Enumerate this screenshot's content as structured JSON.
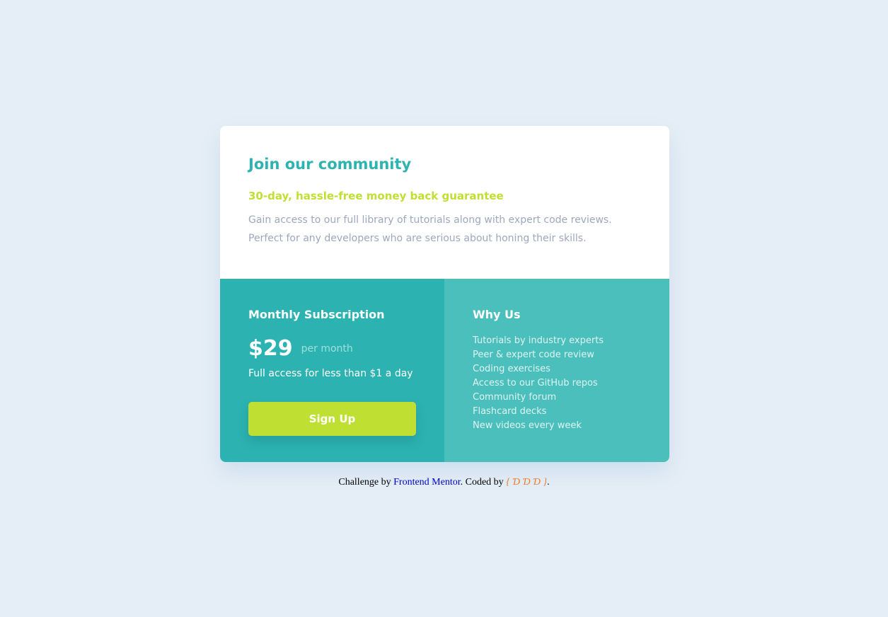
{
  "card": {
    "title": "Join our community",
    "guarantee": "30-day, hassle-free money back guarantee",
    "description": "Gain access to our full library of tutorials along with expert code reviews. Perfect for any developers who are serious about honing their skills."
  },
  "subscription": {
    "title": "Monthly Subscription",
    "price": "$29",
    "period": "per month",
    "access": "Full access for less than $1 a day",
    "button_label": "Sign Up"
  },
  "why_us": {
    "title": "Why Us",
    "items": [
      "Tutorials by industry experts",
      "Peer & expert code review",
      "Coding exercises",
      "Access to our GitHub repos",
      "Community forum",
      "Flashcard decks",
      "New videos every week"
    ]
  },
  "footer": {
    "prefix": "Challenge by ",
    "link_text": "Frontend Mentor",
    "middle": ". Coded by ",
    "coder": "{ Ɗ Ɗ Ɗ }",
    "suffix": "."
  },
  "colors": {
    "background": "#e5eef6",
    "title": "#2eb3b0",
    "guarantee": "#bfe032",
    "description": "#9da8bd",
    "left_panel": "#2bb2b1",
    "right_panel": "#4bbfbc",
    "button": "#bfe032",
    "coder": "#ee7a2e"
  }
}
